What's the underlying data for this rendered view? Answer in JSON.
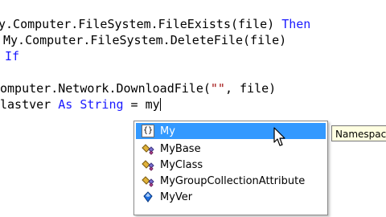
{
  "code": {
    "line1": {
      "prefix": "y.Computer.FileSystem.FileExists(file) ",
      "keyword": "Then"
    },
    "line2": {
      "text": "My.Computer.FileSystem.DeleteFile(file)"
    },
    "line3": {
      "keyword": "If"
    },
    "line4": {
      "prefix": "omputer.Network.DownloadFile(",
      "string": "\"\"",
      "suffix": ", file)"
    },
    "line5": {
      "prefix": "lastver ",
      "kw_as": "As",
      "kw_string": "String",
      "suffix": " = my"
    }
  },
  "intellisense": {
    "items": [
      {
        "label": "My",
        "icon": "namespace-icon",
        "selected": true
      },
      {
        "label": "MyBase",
        "icon": "keyword-icon",
        "selected": false
      },
      {
        "label": "MyClass",
        "icon": "keyword-icon",
        "selected": false
      },
      {
        "label": "MyGroupCollectionAttribute",
        "icon": "class-icon",
        "selected": false
      },
      {
        "label": "MyVer",
        "icon": "variable-icon",
        "selected": false
      }
    ]
  },
  "tooltip": {
    "text": "Namespace"
  },
  "colors": {
    "keyword": "#1a1aff",
    "string": "#a31515",
    "selection": "#3399ff",
    "tooltip_bg": "#ffffe1"
  }
}
